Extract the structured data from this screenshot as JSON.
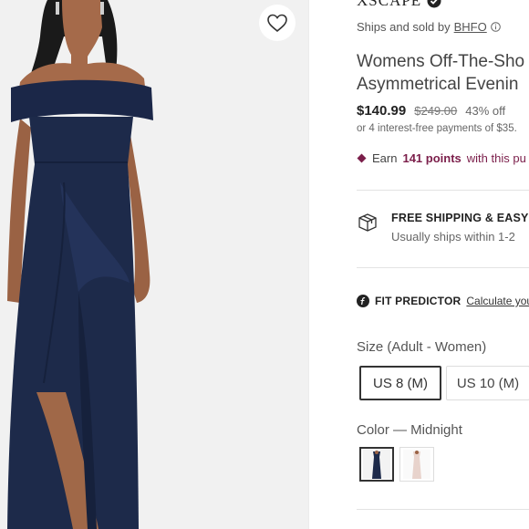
{
  "product": {
    "brand": "XSCAPE",
    "seller_prefix": "Ships and sold by",
    "seller_name": "BHFO",
    "title_line1": "Womens Off-The-Sho",
    "title_line2": "Asymmetrical Evenin",
    "price": "$140.99",
    "original_price": "$249.00",
    "discount": "43% off",
    "installments": "or 4 interest-free payments of $35."
  },
  "rewards": {
    "prefix": "Earn",
    "points": "141 points",
    "suffix": "with this pu"
  },
  "shipping": {
    "title": "FREE SHIPPING & EASY R",
    "subtitle": "Usually ships within 1-2"
  },
  "fit_predictor": {
    "label": "FIT PREDICTOR",
    "link": "Calculate you"
  },
  "size": {
    "label": "Size (Adult - Women)",
    "options": [
      "US 8 (M)",
      "US 10 (M)"
    ],
    "selected": "US 8 (M)"
  },
  "color": {
    "label": "Color — Midnight",
    "swatches": [
      "Midnight",
      "Blush"
    ],
    "selected": "Midnight"
  },
  "colors": {
    "dress": "#1d2a4a",
    "rewards_accent": "#7b1e4a",
    "image_bg": "#f1f1f1"
  },
  "icons": [
    "heart-icon",
    "verified-check-icon",
    "info-icon",
    "diamond-icon",
    "shipping-box-icon",
    "fit-predictor-icon"
  ]
}
